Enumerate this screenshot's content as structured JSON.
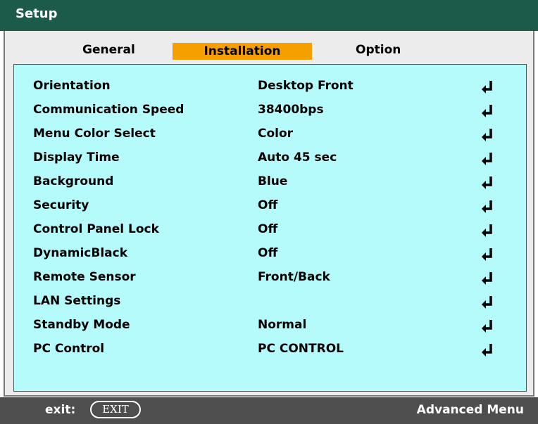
{
  "title": "Setup",
  "tabs": [
    {
      "label": "General",
      "active": false
    },
    {
      "label": "Installation",
      "active": true
    },
    {
      "label": "Option",
      "active": false
    }
  ],
  "rows": [
    {
      "label": "Orientation",
      "value": "Desktop Front"
    },
    {
      "label": "Communication Speed",
      "value": "38400bps"
    },
    {
      "label": "Menu Color Select",
      "value": "Color"
    },
    {
      "label": "Display Time",
      "value": "Auto 45 sec"
    },
    {
      "label": "Background",
      "value": "Blue"
    },
    {
      "label": "Security",
      "value": "Off"
    },
    {
      "label": "Control Panel Lock",
      "value": "Off"
    },
    {
      "label": "DynamicBlack",
      "value": "Off"
    },
    {
      "label": "Remote Sensor",
      "value": "Front/Back"
    },
    {
      "label": "LAN Settings",
      "value": ""
    },
    {
      "label": "Standby Mode",
      "value": "Normal"
    },
    {
      "label": "PC Control",
      "value": "PC CONTROL"
    }
  ],
  "enter_icon": "enter-arrow-icon",
  "footer": {
    "exit_label": "exit:",
    "exit_button": "EXIT",
    "advanced_menu": "Advanced Menu"
  },
  "colors": {
    "title_bar": "#1c5a4a",
    "active_tab": "#f5a000",
    "panel": "#b6fbfb",
    "status_bar": "#4e4e4e"
  }
}
